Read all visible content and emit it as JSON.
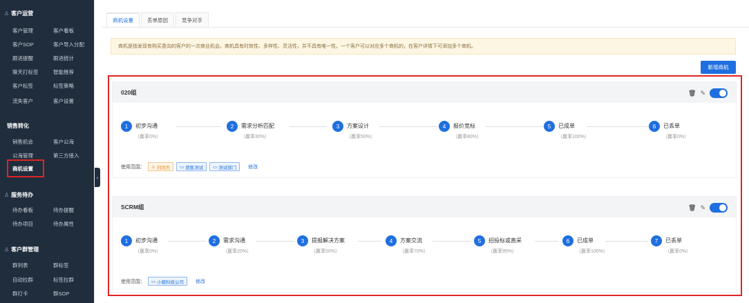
{
  "sidebar": {
    "sections": [
      {
        "title": "客户运营",
        "icon": "user-icon",
        "items": [
          [
            "客户管理",
            "客户看板"
          ],
          [
            "客户SOP",
            "客户导入分配"
          ],
          [
            "跟进提醒",
            "跟进统计"
          ],
          [
            "聊天打标签",
            "智能推荐"
          ],
          [
            "客户标签",
            "标签策略"
          ],
          [
            "流失客户",
            "客户设置"
          ]
        ]
      },
      {
        "title": "销售转化",
        "icon": "",
        "items": [
          [
            "销售机会",
            "客户公海"
          ],
          [
            "公海管理",
            "第三方接入"
          ],
          [
            "商机设置",
            ""
          ]
        ]
      },
      {
        "title": "服务待办",
        "icon": "user-icon",
        "items": [
          [
            "待办看板",
            "待办提醒"
          ],
          [
            "待办项目",
            "待办属性"
          ]
        ]
      },
      {
        "title": "客户群管理",
        "icon": "user-icon",
        "items": [
          [
            "群列表",
            "群标签"
          ],
          [
            "自动拉群",
            "标签拉群"
          ],
          [
            "群打卡",
            "群SOP"
          ]
        ]
      }
    ]
  },
  "tabs": [
    "商机设置",
    "丢单原因",
    "竞争对手"
  ],
  "notice": "商机是指发现有购买意向的客户的一次商业机会。商机具有时效性、多样性、灵活性，并不具有唯一性。一个客户可以对应多个商机的，在客户详情下可添加多个商机。",
  "add_button": "新增商机",
  "scope_label": "使用范围：",
  "edit_label": "修改",
  "groups": [
    {
      "name": "020组",
      "enabled": true,
      "stages": [
        {
          "n": "1",
          "name": "初步沟通",
          "prob": "（赢率0%）"
        },
        {
          "n": "2",
          "name": "需求分析匹配",
          "prob": "（赢率30%）"
        },
        {
          "n": "3",
          "name": "方案设计",
          "prob": "（赢率50%）"
        },
        {
          "n": "4",
          "name": "报价竞标",
          "prob": "（赢率80%）"
        },
        {
          "n": "5",
          "name": "已成单",
          "prob": "（赢率100%）"
        },
        {
          "n": "6",
          "name": "已丢单",
          "prob": "（赢率0%）"
        }
      ],
      "scope_tags": [
        {
          "icon": "user-icon",
          "text": "刘同杰",
          "color": "orange"
        },
        {
          "icon": "folder-icon",
          "text": "销售测试",
          "color": "blue"
        },
        {
          "icon": "folder-icon",
          "text": "测试部门",
          "color": "blue"
        }
      ]
    },
    {
      "name": "SCRM组",
      "enabled": true,
      "stages": [
        {
          "n": "1",
          "name": "初步沟通",
          "prob": "（赢率0%）"
        },
        {
          "n": "2",
          "name": "需求沟通",
          "prob": "（赢率20%）"
        },
        {
          "n": "3",
          "name": "提报解决方案",
          "prob": "（赢率50%）"
        },
        {
          "n": "4",
          "name": "方案交流",
          "prob": "（赢率70%）"
        },
        {
          "n": "5",
          "name": "招投标或直采",
          "prob": "（赢率95%）"
        },
        {
          "n": "6",
          "name": "已成单",
          "prob": "（赢率100%）"
        },
        {
          "n": "7",
          "name": "已丢单",
          "prob": "（赢率0%）"
        }
      ],
      "scope_tags": [
        {
          "icon": "folder-icon",
          "text": "小猪科技公司",
          "color": "blue"
        }
      ]
    }
  ],
  "colors": {
    "accent": "#1f6fe0",
    "sidebar_bg": "#1f2d3d",
    "highlight": "#e02424"
  }
}
